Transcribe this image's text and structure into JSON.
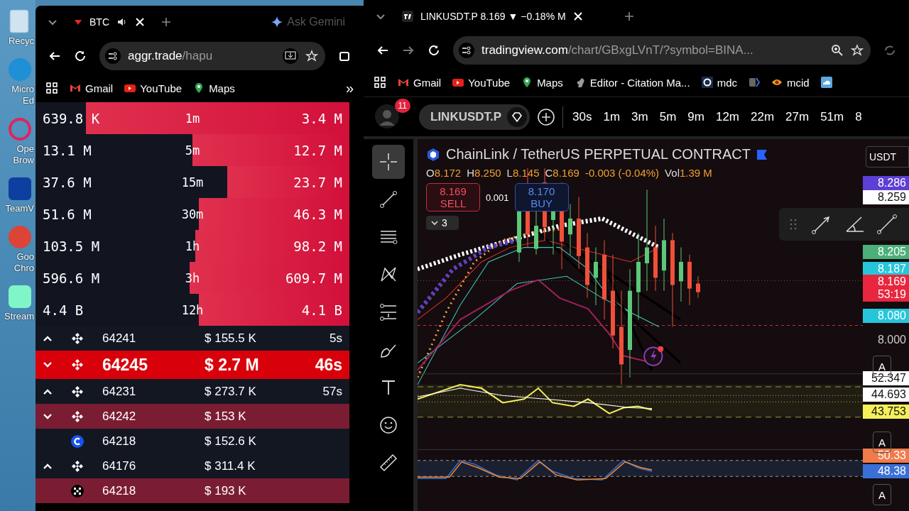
{
  "desktop": {
    "icons": [
      {
        "kind": "recycle",
        "lines": [
          "Recyc"
        ]
      },
      {
        "kind": "edge",
        "lines": [
          "Micro",
          "Ed"
        ]
      },
      {
        "kind": "opera",
        "lines": [
          "Ope",
          "Brow"
        ]
      },
      {
        "kind": "teamviewer",
        "lines": [
          "TeamV"
        ]
      },
      {
        "kind": "chrome",
        "lines": [
          "Goo",
          "Chro"
        ]
      },
      {
        "kind": "stream",
        "lines": [
          "Stream"
        ]
      }
    ]
  },
  "left_browser": {
    "tab": {
      "title": "BTC"
    },
    "ask": "Ask Gemini",
    "url": {
      "host": "aggr.trade",
      "path": "/hapu"
    },
    "bookmarks": [
      {
        "kind": "gmail",
        "label": "Gmail"
      },
      {
        "kind": "youtube",
        "label": "YouTube"
      },
      {
        "kind": "maps",
        "label": "Maps"
      }
    ],
    "more": "»",
    "stats": [
      {
        "buy": "639.8 K",
        "interval": "1m",
        "sell": "3.4 M",
        "level": 0.84
      },
      {
        "buy": "13.1 M",
        "interval": "5m",
        "sell": "12.7 M",
        "level": 0.5
      },
      {
        "buy": "37.6 M",
        "interval": "15m",
        "sell": "23.7 M",
        "level": 0.39
      },
      {
        "buy": "51.6 M",
        "interval": "30m",
        "sell": "46.3 M",
        "level": 0.48
      },
      {
        "buy": "103.5 M",
        "interval": "1h",
        "sell": "98.2 M",
        "level": 0.49
      },
      {
        "buy": "596.6 M",
        "interval": "3h",
        "sell": "609.7 M",
        "level": 0.51
      },
      {
        "buy": "4.4 B",
        "interval": "12h",
        "sell": "4.1 B",
        "level": 0.48
      }
    ],
    "trades": [
      {
        "sell": false,
        "arrow": true,
        "large": false,
        "kind": "binance",
        "price": "64241",
        "amount": "155.5 K",
        "time": "5s"
      },
      {
        "sell": true,
        "arrow": true,
        "large": true,
        "kind": "binance",
        "price": "64245",
        "amount": "2.7 M",
        "time": "46s"
      },
      {
        "sell": false,
        "arrow": true,
        "large": false,
        "kind": "binance",
        "price": "64231",
        "amount": "273.7 K",
        "time": "57s"
      },
      {
        "sell": true,
        "arrow": true,
        "large": false,
        "kind": "binance",
        "price": "64242",
        "amount": "153 K"
      },
      {
        "sell": false,
        "arrow": false,
        "large": false,
        "kind": "coinbase",
        "price": "64218",
        "amount": "152.6 K"
      },
      {
        "sell": false,
        "arrow": true,
        "large": false,
        "kind": "binance",
        "price": "64176",
        "amount": "311.4 K"
      },
      {
        "sell": true,
        "arrow": false,
        "large": false,
        "kind": "okx",
        "price": "64218",
        "amount": "193 K"
      }
    ],
    "currency_sign": "$"
  },
  "right_browser": {
    "tab": {
      "title": "LINKUSDT.P 8.169 ▼ −0.18% M"
    },
    "url": {
      "host": "tradingview.com",
      "path": "/chart/GBxgLVnT/?symbol=BINA..."
    },
    "bookmarks": [
      {
        "kind": "gmail",
        "label": "Gmail"
      },
      {
        "kind": "youtube",
        "label": "YouTube"
      },
      {
        "kind": "maps",
        "label": "Maps"
      },
      {
        "kind": "squirrel",
        "label": "Editor - Citation Ma..."
      },
      {
        "kind": "ring",
        "label": "mdc"
      },
      {
        "kind": "arrow"
      },
      {
        "kind": "eye",
        "label": "mcid"
      },
      {
        "kind": "cloud"
      }
    ],
    "toolbar": {
      "badge": "11",
      "symbol": "LINKUSDT.P",
      "intervals": [
        "30s",
        "1m",
        "3m",
        "5m",
        "9m",
        "12m",
        "22m",
        "27m",
        "51m",
        "8"
      ]
    },
    "tools": [
      {
        "kind": "crosshair",
        "selected": true
      },
      {
        "kind": "line",
        "selected": false
      },
      {
        "kind": "hlines",
        "selected": false
      },
      {
        "kind": "pattern",
        "selected": false
      },
      {
        "kind": "fib",
        "selected": false
      },
      {
        "kind": "brush",
        "selected": false
      },
      {
        "kind": "text",
        "selected": false
      },
      {
        "kind": "emoji",
        "selected": false
      },
      {
        "kind": "ruler",
        "selected": false
      }
    ],
    "chart": {
      "title": "ChainLink / TetherUS PERPETUAL CONTRACT",
      "ohlc": [
        {
          "key": "O",
          "value": "8.172"
        },
        {
          "key": "H",
          "value": "8.250"
        },
        {
          "key": "L",
          "value": "8.145"
        },
        {
          "key": "C",
          "value": "8.169"
        }
      ],
      "change": "-0.003 (-0.04%)",
      "vol_key": "Vol",
      "vol": "1.39 M",
      "sell": {
        "price": "8.169",
        "label": "SELL"
      },
      "spread": "0.001",
      "buy": {
        "price": "8.170",
        "label": "BUY"
      },
      "collapsed_count": "3",
      "currency": "USDT",
      "price_labels": [
        {
          "text": "8.286",
          "color": "#5e3fd6"
        },
        {
          "text": "8.259",
          "color": "#ffffff"
        },
        {
          "text": "8.205",
          "color": "#4caf7a"
        },
        {
          "text": "8.187",
          "color": "#26c6da"
        },
        {
          "text": "8.169",
          "sub": "53:19",
          "color": "#e8263d"
        },
        {
          "text": "8.080",
          "color": "#26c6da"
        },
        {
          "text": "8.000"
        },
        {
          "text": "52.347",
          "color": "#ffffff"
        },
        {
          "text": "44.693",
          "color": "#ffffff"
        },
        {
          "text": "43.753",
          "color": "#f5f05a"
        },
        {
          "text": "50.33",
          "color": "#f07a4a"
        },
        {
          "text": "48.38",
          "color": "#3a6fd8"
        }
      ],
      "auto_buttons": [
        "A",
        "A",
        "A"
      ]
    }
  }
}
